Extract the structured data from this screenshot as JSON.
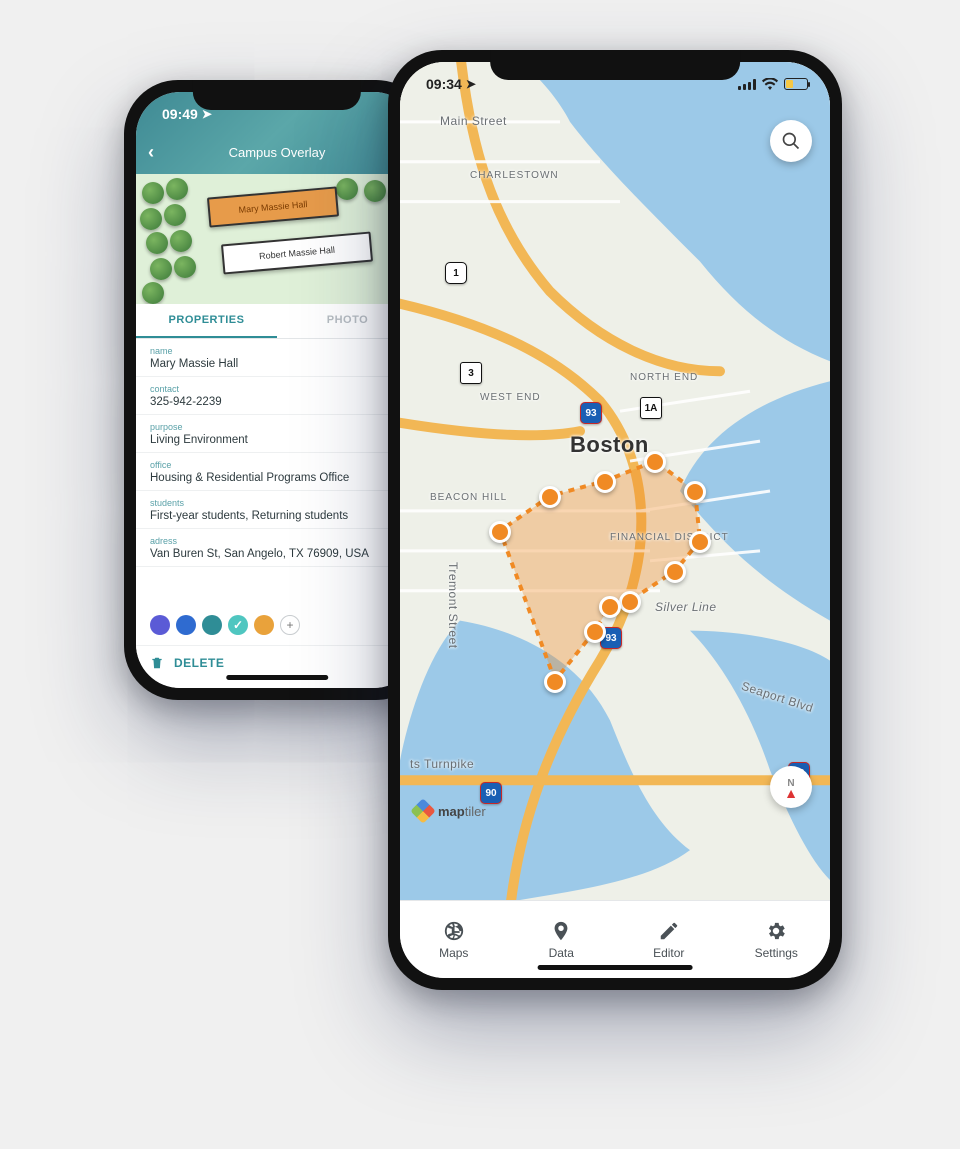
{
  "phone_left": {
    "status_time": "09:49",
    "title": "Campus Overlay",
    "buildings": {
      "selected": "Mary Massie Hall",
      "other": "Robert Massie Hall"
    },
    "tabs": {
      "properties": "PROPERTIES",
      "photo": "PHOTO"
    },
    "fields": [
      {
        "label": "name",
        "value": "Mary Massie Hall"
      },
      {
        "label": "contact",
        "value": "325-942-2239"
      },
      {
        "label": "purpose",
        "value": "Living Environment"
      },
      {
        "label": "office",
        "value": "Housing & Residential Programs Office"
      },
      {
        "label": "students",
        "value": "First-year students, Returning students"
      },
      {
        "label": "adress",
        "value": "Van Buren St, San Angelo, TX 76909, USA"
      }
    ],
    "swatches": [
      "#5b5bd6",
      "#2f6bd0",
      "#2f8d96",
      "#4fc6c0",
      "#e9a23b"
    ],
    "swatch_selected_index": 3,
    "delete_label": "DELETE"
  },
  "phone_right": {
    "status_time": "09:34",
    "city_label": "Boston",
    "districts": {
      "charlestown": "CHARLESTOWN",
      "north_end": "NORTH END",
      "west_end": "WEST END",
      "beacon_hill": "BEACON HILL",
      "financial": "FINANCIAL DISTRICT",
      "seaport": "Seaport Blvd",
      "silver": "Silver Line",
      "tremont": "Tremont Street",
      "turnpike": "ts Turnpike",
      "main": "Main Street"
    },
    "shields": {
      "i93": "93",
      "i90": "90",
      "us1": "1",
      "r3": "3",
      "r1a": "1A"
    },
    "attribution_brand": "map",
    "attribution_suffix": "tiler",
    "compass_n": "N",
    "nav": {
      "maps": "Maps",
      "data": "Data",
      "editor": "Editor",
      "settings": "Settings"
    }
  }
}
